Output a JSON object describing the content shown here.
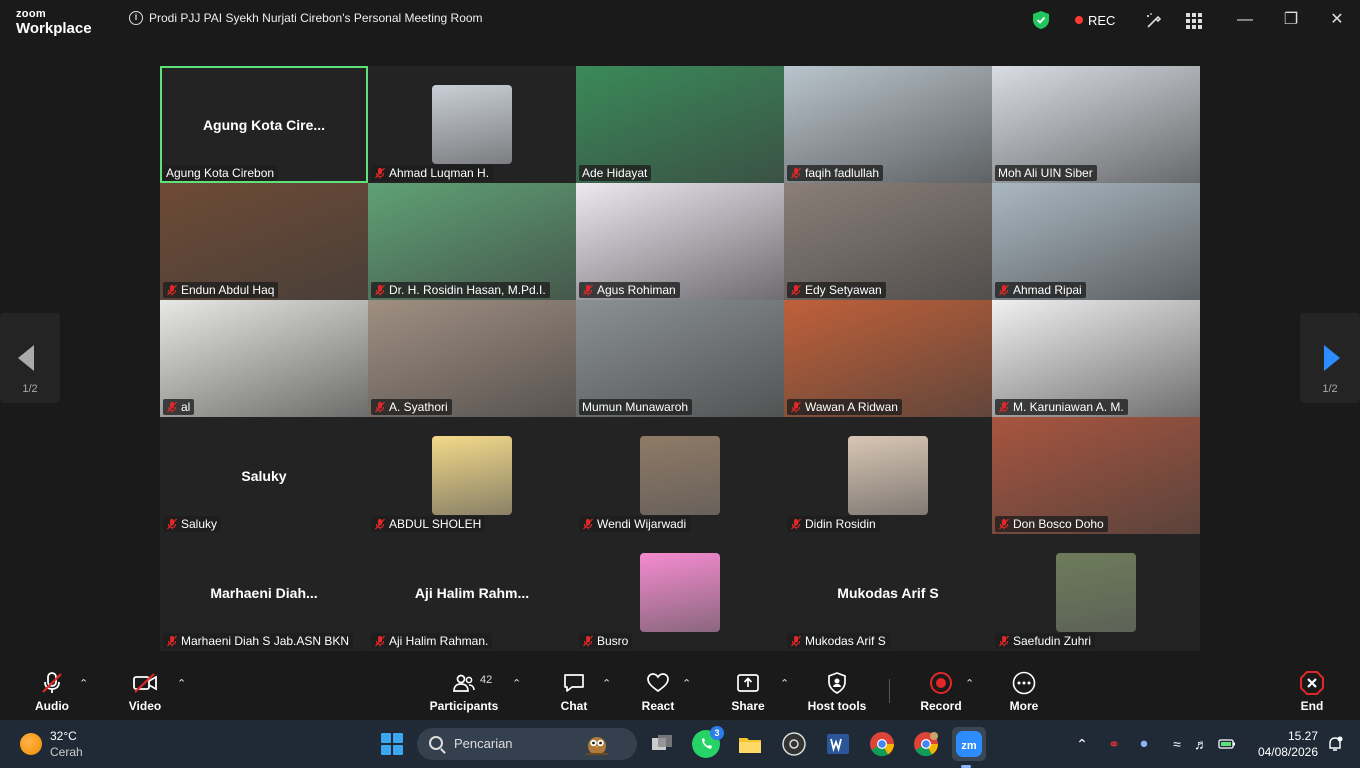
{
  "window": {
    "brand_line1": "zoom",
    "brand_line2": "Workplace",
    "title": "Prodi PJJ PAI Syekh Nurjati Cirebon's Personal Meeting Room",
    "rec_label": "REC"
  },
  "pagination": {
    "left": "1/2",
    "right": "1/2"
  },
  "participants": [
    {
      "name": "Agung Kota Cirebon",
      "display": "Agung  Kota  Cire...",
      "mode": "name",
      "active": true,
      "muted": false
    },
    {
      "name": "Ahmad Luqman H.",
      "mode": "thumb",
      "muted": true,
      "color": "#c9cfd6"
    },
    {
      "name": "Ade Hidayat",
      "mode": "video",
      "muted": false,
      "color": "#3a8a5a"
    },
    {
      "name": "faqih fadlullah",
      "mode": "video",
      "muted": true,
      "color": "#b9c4cc"
    },
    {
      "name": "Moh Ali UIN Siber",
      "mode": "video",
      "muted": false,
      "color": "#d9dde4"
    },
    {
      "name": "Endun Abdul Haq",
      "mode": "video",
      "muted": true,
      "color": "#6e4a35"
    },
    {
      "name": "Dr. H. Rosidin Hasan, M.Pd.I.",
      "mode": "video",
      "muted": true,
      "color": "#5fa176"
    },
    {
      "name": "Agus Rohiman",
      "mode": "video",
      "muted": true,
      "color": "#ede8f2"
    },
    {
      "name": "Edy Setyawan",
      "mode": "video",
      "muted": true,
      "color": "#8a7f78"
    },
    {
      "name": "Ahmad Ripai",
      "mode": "video",
      "muted": true,
      "color": "#aab8c2"
    },
    {
      "name": "al",
      "mode": "video",
      "muted": true,
      "color": "#e8e8e6"
    },
    {
      "name": "A. Syathori",
      "mode": "video",
      "muted": true,
      "color": "#a08f82"
    },
    {
      "name": "Mumun Munawaroh",
      "mode": "video",
      "muted": false,
      "color": "#8b9193"
    },
    {
      "name": "Wawan A Ridwan",
      "mode": "video",
      "muted": true,
      "color": "#c0603a"
    },
    {
      "name": "M. Karuniawan A. M.",
      "mode": "video",
      "muted": true,
      "color": "#f0f0f0"
    },
    {
      "name": "Saluky",
      "display": "Saluky",
      "mode": "name",
      "muted": true
    },
    {
      "name": "ABDUL SHOLEH",
      "mode": "thumb",
      "muted": true,
      "color": "#f3d98a"
    },
    {
      "name": "Wendi Wijarwadi",
      "mode": "thumb",
      "muted": true,
      "color": "#8f7a66"
    },
    {
      "name": "Didin Rosidin",
      "mode": "thumb",
      "muted": true,
      "color": "#d8c6b4"
    },
    {
      "name": "Don Bosco Doho",
      "mode": "video",
      "muted": true,
      "color": "#a8553f"
    },
    {
      "name": "Marhaeni Diah S Jab.ASN BKN",
      "display": "Marhaeni  Diah...",
      "mode": "name",
      "muted": true
    },
    {
      "name": "Aji Halim Rahman.",
      "display": "Aji  Halim  Rahm...",
      "mode": "name",
      "muted": true
    },
    {
      "name": "Busro",
      "mode": "thumb",
      "muted": true,
      "color": "#f58bd0"
    },
    {
      "name": "Mukodas Arif S",
      "display": "Mukodas Arif S",
      "mode": "name",
      "muted": true
    },
    {
      "name": "Saefudin Zuhri",
      "mode": "thumb",
      "muted": true,
      "color": "#6d7c5a"
    }
  ],
  "toolbar": {
    "audio": "Audio",
    "video": "Video",
    "participants": "Participants",
    "participants_count": "42",
    "chat": "Chat",
    "react": "React",
    "share": "Share",
    "host_tools": "Host tools",
    "record": "Record",
    "more": "More",
    "end": "End"
  },
  "taskbar": {
    "temperature": "32°C",
    "condition": "Cerah",
    "search_placeholder": "Pencarian",
    "whatsapp_badge": "3",
    "time": "15.27",
    "date": "04/08/2026"
  },
  "colors": {
    "active_border": "#5ee07a",
    "rec_red": "#ff3b30",
    "end_red": "#e02828",
    "accent_blue": "#2d8cff"
  }
}
